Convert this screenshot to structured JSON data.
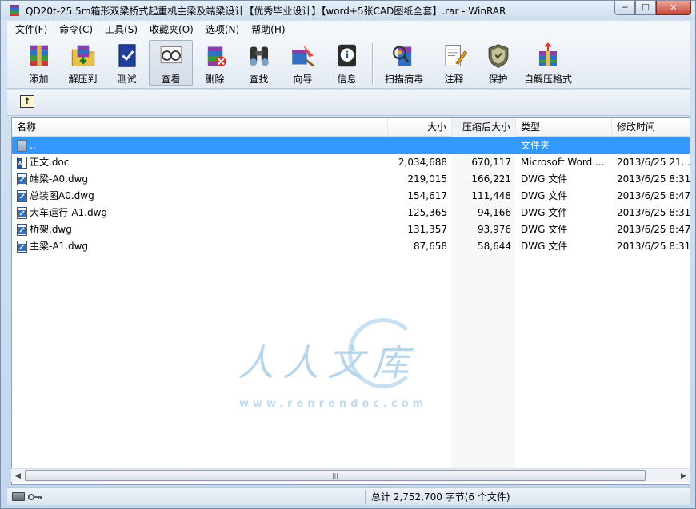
{
  "window": {
    "title": "QD20t-25.5m箱形双梁桥式起重机主梁及端梁设计【优秀毕业设计】【word+5张CAD图纸全套】.rar - WinRAR",
    "minimize_glyph": "─",
    "maximize_glyph": "☐",
    "close_glyph": "✕"
  },
  "menu": {
    "items": [
      {
        "label": "文件(F)"
      },
      {
        "label": "命令(C)"
      },
      {
        "label": "工具(S)"
      },
      {
        "label": "收藏夹(O)"
      },
      {
        "label": "选项(N)"
      },
      {
        "label": "帮助(H)"
      }
    ]
  },
  "toolbar": {
    "buttons": [
      {
        "label": "添加",
        "icon": "add-archive-icon"
      },
      {
        "label": "解压到",
        "icon": "extract-to-icon"
      },
      {
        "label": "测试",
        "icon": "test-icon"
      },
      {
        "label": "查看",
        "icon": "view-icon",
        "pressed": true
      },
      {
        "label": "删除",
        "icon": "delete-icon"
      },
      {
        "label": "查找",
        "icon": "find-icon"
      },
      {
        "label": "向导",
        "icon": "wizard-icon"
      },
      {
        "label": "信息",
        "icon": "info-icon"
      },
      {
        "label": "扫描病毒",
        "icon": "virus-scan-icon"
      },
      {
        "label": "注释",
        "icon": "comment-icon"
      },
      {
        "label": "保护",
        "icon": "protect-icon"
      },
      {
        "label": "自解压格式",
        "icon": "sfx-icon"
      }
    ]
  },
  "address": {
    "up_icon": "folder-up-icon",
    "up_glyph": "↑"
  },
  "file_list": {
    "columns": {
      "name": "名称",
      "size": "大小",
      "packed": "压缩后大小",
      "type": "类型",
      "modified": "修改时间"
    },
    "rows": [
      {
        "name": "..",
        "size": "",
        "packed": "",
        "type": "文件夹",
        "modified": "",
        "icon": "parent-folder-icon",
        "selected": true
      },
      {
        "name": "正文.doc",
        "size": "2,034,688",
        "packed": "670,117",
        "type": "Microsoft Word ...",
        "modified": "2013/6/25 21...",
        "icon": "word-doc-icon",
        "selected": false
      },
      {
        "name": "端梁-A0.dwg",
        "size": "219,015",
        "packed": "166,221",
        "type": "DWG 文件",
        "modified": "2013/6/25 8:31",
        "icon": "dwg-file-icon",
        "selected": false
      },
      {
        "name": "总装图A0.dwg",
        "size": "154,617",
        "packed": "111,448",
        "type": "DWG 文件",
        "modified": "2013/6/25 8:47",
        "icon": "dwg-file-icon",
        "selected": false
      },
      {
        "name": "大车运行-A1.dwg",
        "size": "125,365",
        "packed": "94,166",
        "type": "DWG 文件",
        "modified": "2013/6/25 8:31",
        "icon": "dwg-file-icon",
        "selected": false
      },
      {
        "name": "桥架.dwg",
        "size": "131,357",
        "packed": "93,976",
        "type": "DWG 文件",
        "modified": "2013/6/25 8:47",
        "icon": "dwg-file-icon",
        "selected": false
      },
      {
        "name": "主梁-A1.dwg",
        "size": "87,658",
        "packed": "58,644",
        "type": "DWG 文件",
        "modified": "2013/6/25 8:31",
        "icon": "dwg-file-icon",
        "selected": false
      }
    ]
  },
  "watermark": {
    "cn": "人人文库",
    "url": "www.renrendoc.com"
  },
  "scrollbar": {
    "left_glyph": "◀",
    "right_glyph": "▶",
    "thumb_grip": "|||"
  },
  "status": {
    "text": "总计 2,752,700 字节(6 个文件)"
  },
  "colors": {
    "selection": "#3399ff",
    "title_bar": "#d6e4f3",
    "close_button": "#c7463a"
  }
}
